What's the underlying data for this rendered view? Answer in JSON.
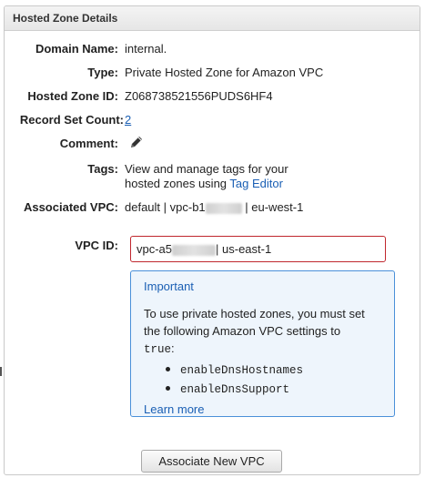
{
  "panel": {
    "title": "Hosted Zone Details"
  },
  "fields": {
    "domain_name": {
      "label": "Domain Name:",
      "value": "internal."
    },
    "type": {
      "label": "Type:",
      "value": "Private Hosted Zone for Amazon VPC"
    },
    "hosted_zone_id": {
      "label": "Hosted Zone ID:",
      "value": "Z068738521556PUDS6HF4"
    },
    "record_set_count": {
      "label": "Record Set Count:",
      "value": "2"
    },
    "comment": {
      "label": "Comment:",
      "icon": "pencil-icon"
    },
    "tags": {
      "label": "Tags:",
      "line1": "View and manage tags for your",
      "line2_prefix": "hosted zones using",
      "link": "Tag Editor"
    },
    "associated_vpc": {
      "label": "Associated VPC:",
      "prefix": "default | vpc-b1",
      "suffix": "| eu-west-1"
    }
  },
  "vpc_id": {
    "label": "VPC ID:",
    "value_prefix": "vpc-a5",
    "value_suffix": "| us-east-1"
  },
  "important": {
    "title": "Important",
    "text_line1": "To use private hosted zones, you must set",
    "text_line2": "the following Amazon VPC settings to",
    "code_true": "true",
    "code_colon": ":",
    "settings": [
      "enableDnsHostnames",
      "enableDnsSupport"
    ],
    "learn_more": "Learn more"
  },
  "actions": {
    "associate_label": "Associate New VPC"
  },
  "colors": {
    "link": "#1a5fb4",
    "error_border": "#c0272d",
    "info_border": "#4a90d9",
    "info_bg": "#eef5fc"
  }
}
